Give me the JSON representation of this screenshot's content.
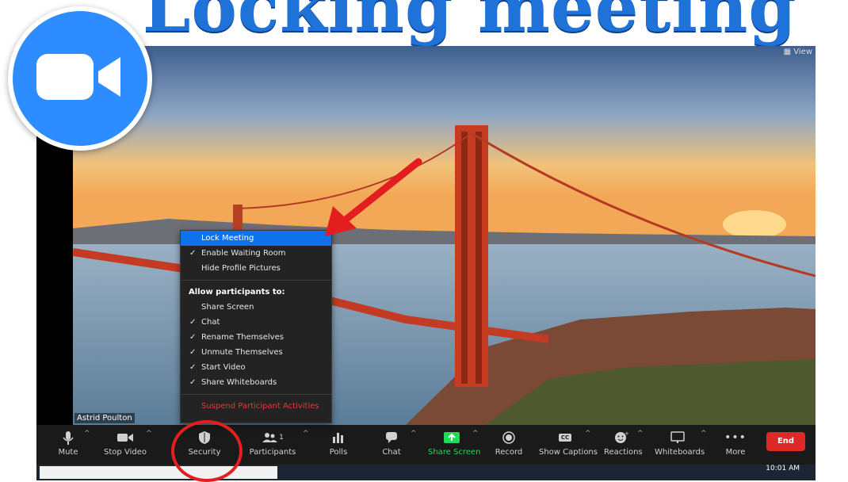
{
  "banner": {
    "title": "Locking meeting"
  },
  "logo": {
    "icon": "zoom-camera-icon",
    "color": "#2d8cff"
  },
  "header": {
    "view_label": "View"
  },
  "video": {
    "participant_name": "Astrid Poulton"
  },
  "security_menu": {
    "items": [
      {
        "label": "Lock Meeting",
        "checked": false,
        "active": true
      },
      {
        "label": "Enable Waiting Room",
        "checked": true,
        "active": false
      },
      {
        "label": "Hide Profile Pictures",
        "checked": false,
        "active": false
      }
    ],
    "section_header": "Allow participants to:",
    "allow_items": [
      {
        "label": "Share Screen",
        "checked": false
      },
      {
        "label": "Chat",
        "checked": true
      },
      {
        "label": "Rename Themselves",
        "checked": true
      },
      {
        "label": "Unmute Themselves",
        "checked": true
      },
      {
        "label": "Start Video",
        "checked": true
      },
      {
        "label": "Share Whiteboards",
        "checked": true
      }
    ],
    "suspend_label": "Suspend Participant Activities"
  },
  "toolbar": {
    "mute": "Mute",
    "stop_video": "Stop Video",
    "security": "Security",
    "participants": "Participants",
    "participants_count": "1",
    "polls": "Polls",
    "chat": "Chat",
    "share_screen": "Share Screen",
    "record": "Record",
    "show_captions": "Show Captions",
    "captions_badge": "CC",
    "reactions": "Reactions",
    "whiteboards": "Whiteboards",
    "more": "More",
    "end": "End"
  },
  "taskbar": {
    "clock": "10:01 AM"
  },
  "colors": {
    "accent": "#0e72ed",
    "danger": "#e43a3a",
    "share_green": "#23d959",
    "annotation_red": "#e21e1e"
  }
}
